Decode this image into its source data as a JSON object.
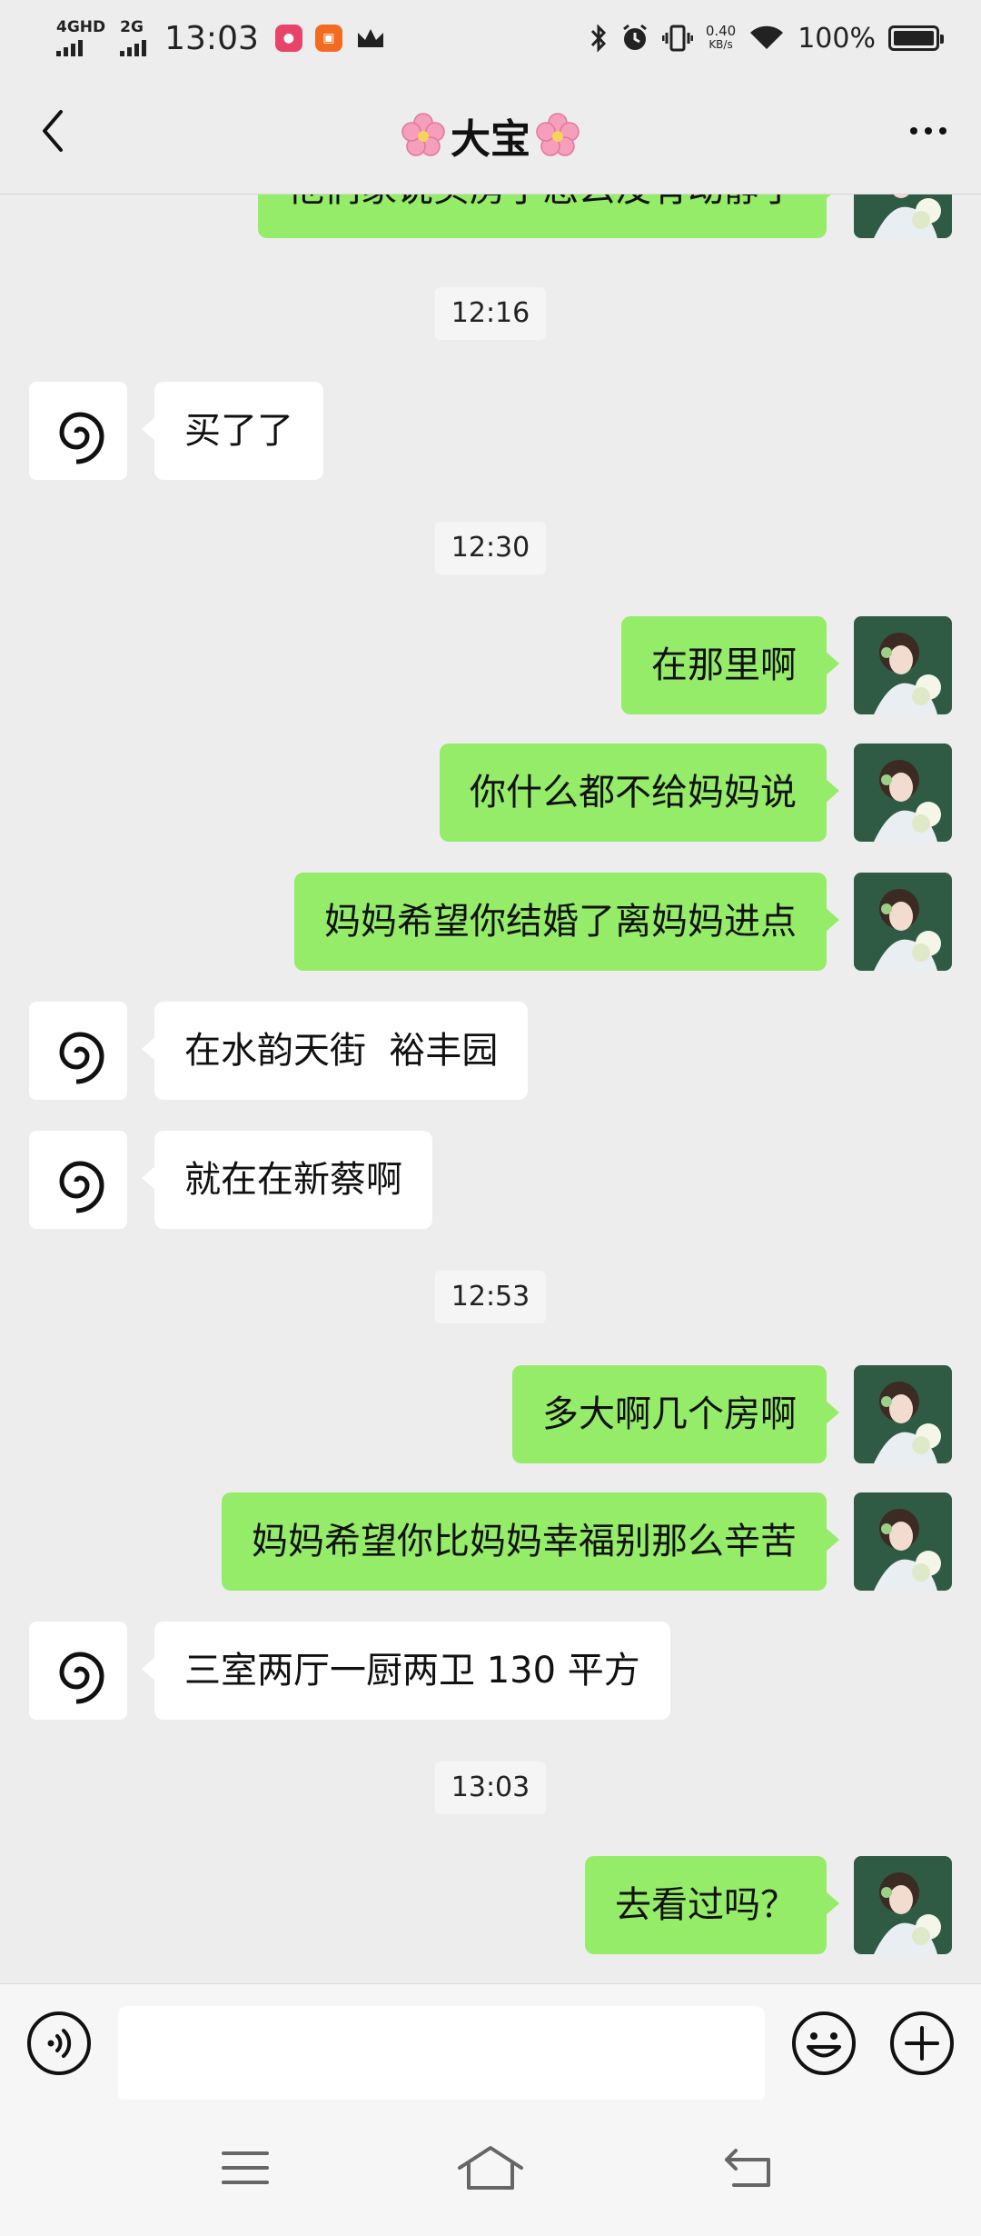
{
  "status_bar": {
    "network_primary": "4GHD",
    "network_secondary": "2G",
    "time": "13:03",
    "speed_value": "0.40",
    "speed_unit": "KB/s",
    "battery_percent": "100%"
  },
  "header": {
    "title": "大宝",
    "back_icon": "chevron-left-icon",
    "more_icon": "more-dots-icon",
    "title_decoration": "cherry-blossom-icon"
  },
  "messages": [
    {
      "kind": "outgoing",
      "text": "他们家说买房子怎么没有动静了"
    },
    {
      "kind": "timestamp",
      "text": "12:16"
    },
    {
      "kind": "incoming",
      "text": "买了了"
    },
    {
      "kind": "timestamp",
      "text": "12:30"
    },
    {
      "kind": "outgoing",
      "text": "在那里啊"
    },
    {
      "kind": "outgoing",
      "text": "你什么都不给妈妈说"
    },
    {
      "kind": "outgoing",
      "text": "妈妈希望你结婚了离妈妈进点"
    },
    {
      "kind": "incoming",
      "text": "在水韵天街  裕丰园"
    },
    {
      "kind": "incoming",
      "text": "就在在新蔡啊"
    },
    {
      "kind": "timestamp",
      "text": "12:53"
    },
    {
      "kind": "outgoing",
      "text": "多大啊几个房啊"
    },
    {
      "kind": "outgoing",
      "text": "妈妈希望你比妈妈幸福别那么辛苦"
    },
    {
      "kind": "incoming",
      "text": "三室两厅一厨两卫 130 平方"
    },
    {
      "kind": "timestamp",
      "text": "13:03"
    },
    {
      "kind": "outgoing",
      "text": "去看过吗？"
    }
  ],
  "input_bar": {
    "value": "",
    "voice_icon": "voice-icon",
    "emoji_icon": "emoji-icon",
    "plus_icon": "plus-icon"
  },
  "nav_bar": {
    "menu_icon": "menu-icon",
    "home_icon": "home-icon",
    "back_icon": "back-icon"
  },
  "colors": {
    "background": "#ededed",
    "outgoing_bubble": "#95ec69",
    "incoming_bubble": "#ffffff"
  }
}
